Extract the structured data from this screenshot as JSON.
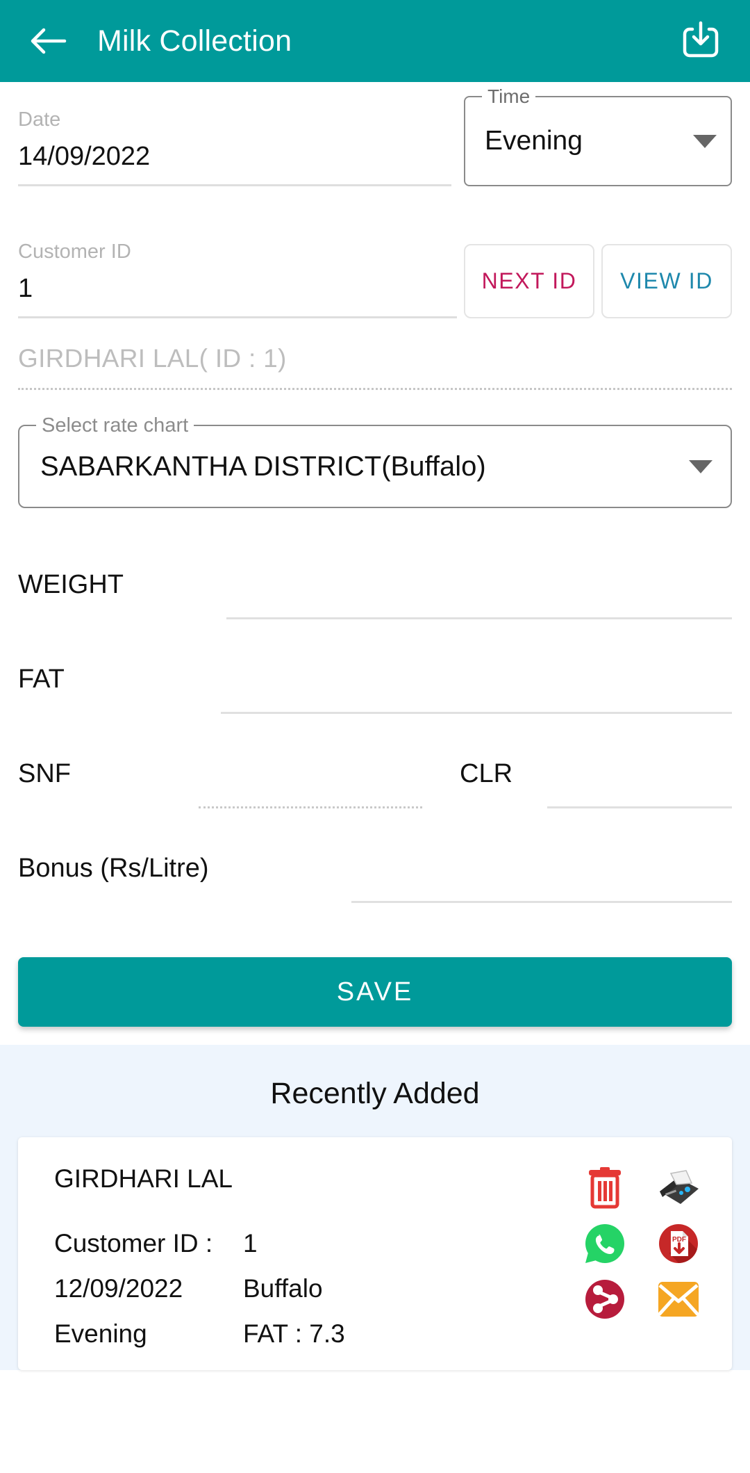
{
  "appbar": {
    "title": "Milk Collection",
    "back_icon": "arrow-left-icon",
    "download_icon": "download-icon"
  },
  "form": {
    "date": {
      "label": "Date",
      "value": "14/09/2022"
    },
    "time": {
      "label": "Time",
      "value": "Evening"
    },
    "customer_id": {
      "label": "Customer ID",
      "value": "1"
    },
    "next_id_button": "NEXT ID",
    "view_id_button": "VIEW ID",
    "customer_name_line": "GIRDHARI LAL( ID : 1)",
    "rate_chart": {
      "label": "Select rate chart",
      "value": "SABARKANTHA DISTRICT(Buffalo)"
    },
    "weight": {
      "label": "WEIGHT",
      "value": ""
    },
    "fat": {
      "label": "FAT",
      "value": ""
    },
    "snf": {
      "label": "SNF",
      "value": ""
    },
    "clr": {
      "label": "CLR",
      "value": ""
    },
    "bonus": {
      "label": "Bonus (Rs/Litre)",
      "value": ""
    },
    "save_button": "SAVE"
  },
  "recent": {
    "title": "Recently Added",
    "entry": {
      "name": "GIRDHARI LAL",
      "customer_id_label": "Customer ID :",
      "customer_id_value": "1",
      "date": "12/09/2022",
      "animal": "Buffalo",
      "shift": "Evening",
      "fat": "FAT : 7.3"
    },
    "actions": [
      {
        "name": "delete-icon"
      },
      {
        "name": "printer-icon"
      },
      {
        "name": "whatsapp-icon"
      },
      {
        "name": "pdf-download-icon"
      },
      {
        "name": "share-icon"
      },
      {
        "name": "email-icon"
      }
    ]
  },
  "colors": {
    "primary": "#009a9a",
    "next_id": "#c2185b",
    "view_id": "#1e88ac",
    "recent_bg": "#eef5fd",
    "delete_red": "#e53935",
    "whatsapp_green": "#25d366",
    "pdf_red": "#c62828",
    "share_red": "#b71c3c",
    "email_orange": "#f5a623"
  }
}
